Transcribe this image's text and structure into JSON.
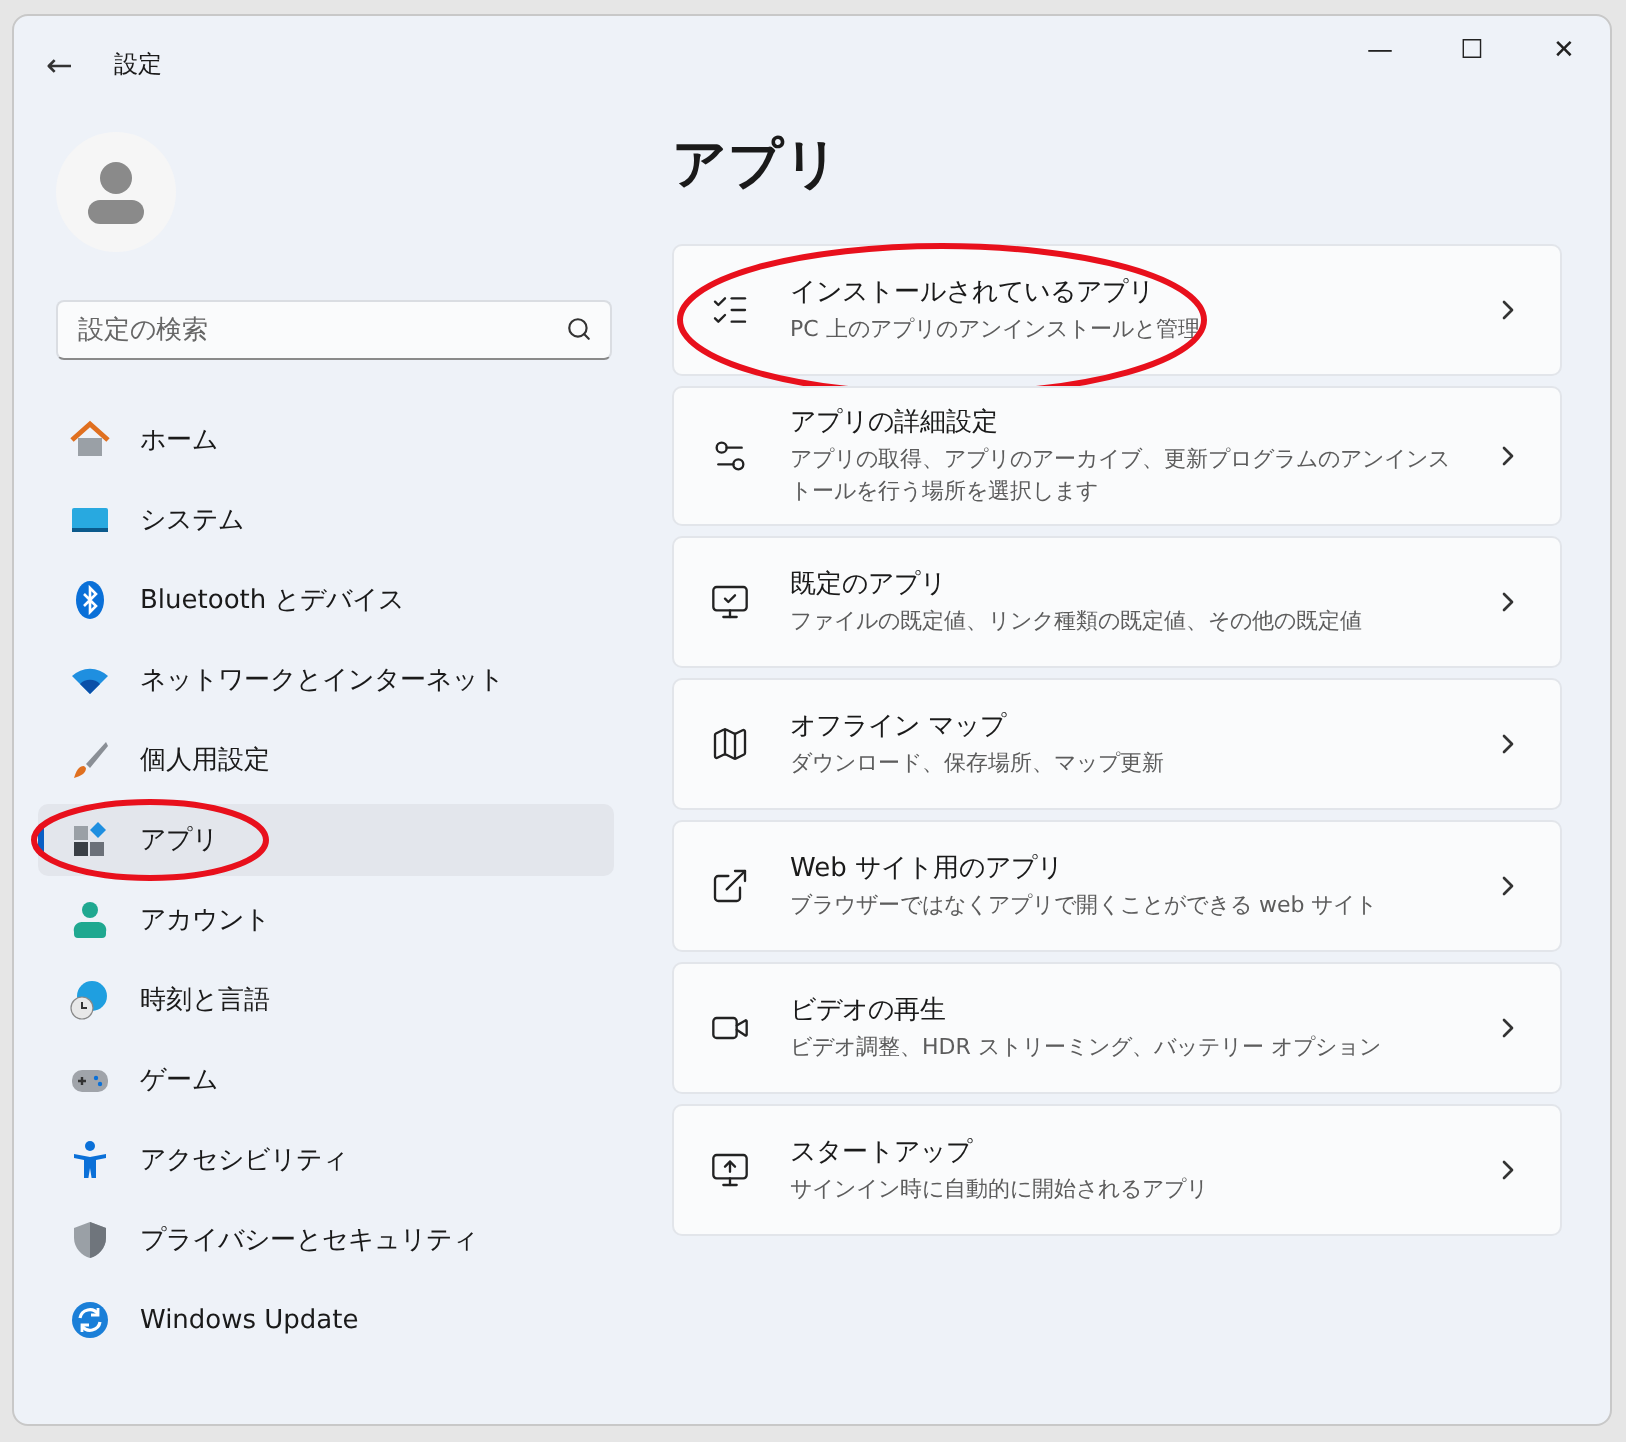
{
  "window": {
    "title": "設定",
    "back": "←",
    "minimize": "—",
    "maximize": "☐",
    "close": "✕"
  },
  "search": {
    "placeholder": "設定の検索"
  },
  "nav": [
    {
      "label": "ホーム",
      "selected": false,
      "circled": false
    },
    {
      "label": "システム",
      "selected": false,
      "circled": false
    },
    {
      "label": "Bluetooth とデバイス",
      "selected": false,
      "circled": false
    },
    {
      "label": "ネットワークとインターネット",
      "selected": false,
      "circled": false
    },
    {
      "label": "個人用設定",
      "selected": false,
      "circled": false
    },
    {
      "label": "アプリ",
      "selected": true,
      "circled": true
    },
    {
      "label": "アカウント",
      "selected": false,
      "circled": false
    },
    {
      "label": "時刻と言語",
      "selected": false,
      "circled": false
    },
    {
      "label": "ゲーム",
      "selected": false,
      "circled": false
    },
    {
      "label": "アクセシビリティ",
      "selected": false,
      "circled": false
    },
    {
      "label": "プライバシーとセキュリティ",
      "selected": false,
      "circled": false
    },
    {
      "label": "Windows Update",
      "selected": false,
      "circled": false
    }
  ],
  "page_title": "アプリ",
  "cards": [
    {
      "title": "インストールされているアプリ",
      "subtitle": "PC 上のアプリのアンインストールと管理",
      "circled": true
    },
    {
      "title": "アプリの詳細設定",
      "subtitle": "アプリの取得、アプリのアーカイブ、更新プログラムのアンインストールを行う場所を選択します",
      "circled": false
    },
    {
      "title": "既定のアプリ",
      "subtitle": "ファイルの既定値、リンク種類の既定値、その他の既定値",
      "circled": false
    },
    {
      "title": "オフライン マップ",
      "subtitle": "ダウンロード、保存場所、マップ更新",
      "circled": false
    },
    {
      "title": "Web サイト用のアプリ",
      "subtitle": "ブラウザーではなくアプリで開くことができる web サイト",
      "circled": false
    },
    {
      "title": "ビデオの再生",
      "subtitle": "ビデオ調整、HDR ストリーミング、バッテリー オプション",
      "circled": false
    },
    {
      "title": "スタートアップ",
      "subtitle": "サインイン時に自動的に開始されるアプリ",
      "circled": false
    }
  ]
}
